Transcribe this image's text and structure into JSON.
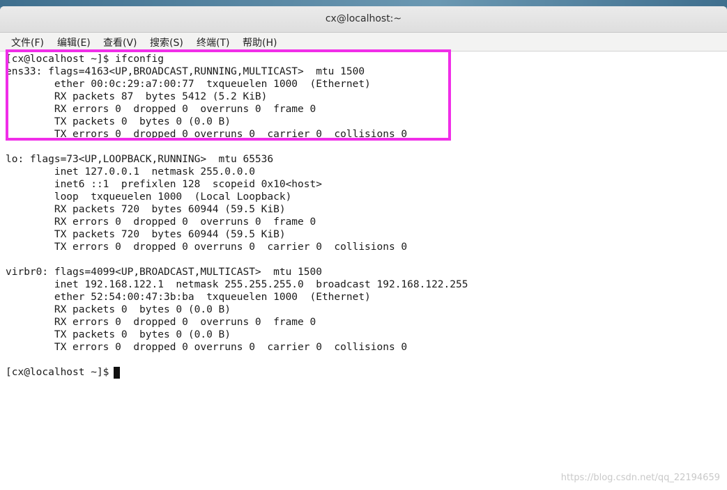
{
  "window": {
    "title": "cx@localhost:~"
  },
  "menubar": {
    "items": [
      {
        "label": "文件(F)"
      },
      {
        "label": "编辑(E)"
      },
      {
        "label": "查看(V)"
      },
      {
        "label": "搜索(S)"
      },
      {
        "label": "终端(T)"
      },
      {
        "label": "帮助(H)"
      }
    ]
  },
  "terminal": {
    "lines": [
      "[cx@localhost ~]$ ifconfig",
      "ens33: flags=4163<UP,BROADCAST,RUNNING,MULTICAST>  mtu 1500",
      "        ether 00:0c:29:a7:00:77  txqueuelen 1000  (Ethernet)",
      "        RX packets 87  bytes 5412 (5.2 KiB)",
      "        RX errors 0  dropped 0  overruns 0  frame 0",
      "        TX packets 0  bytes 0 (0.0 B)",
      "        TX errors 0  dropped 0 overruns 0  carrier 0  collisions 0",
      "",
      "lo: flags=73<UP,LOOPBACK,RUNNING>  mtu 65536",
      "        inet 127.0.0.1  netmask 255.0.0.0",
      "        inet6 ::1  prefixlen 128  scopeid 0x10<host>",
      "        loop  txqueuelen 1000  (Local Loopback)",
      "        RX packets 720  bytes 60944 (59.5 KiB)",
      "        RX errors 0  dropped 0  overruns 0  frame 0",
      "        TX packets 720  bytes 60944 (59.5 KiB)",
      "        TX errors 0  dropped 0 overruns 0  carrier 0  collisions 0",
      "",
      "virbr0: flags=4099<UP,BROADCAST,MULTICAST>  mtu 1500",
      "        inet 192.168.122.1  netmask 255.255.255.0  broadcast 192.168.122.255",
      "        ether 52:54:00:47:3b:ba  txqueuelen 1000  (Ethernet)",
      "        RX packets 0  bytes 0 (0.0 B)",
      "        RX errors 0  dropped 0  overruns 0  frame 0",
      "        TX packets 0  bytes 0 (0.0 B)",
      "        TX errors 0  dropped 0 overruns 0  carrier 0  collisions 0",
      "",
      "[cx@localhost ~]$ "
    ]
  },
  "watermark": "https://blog.csdn.net/qq_22194659",
  "colors": {
    "highlight": "#f02ee8"
  }
}
